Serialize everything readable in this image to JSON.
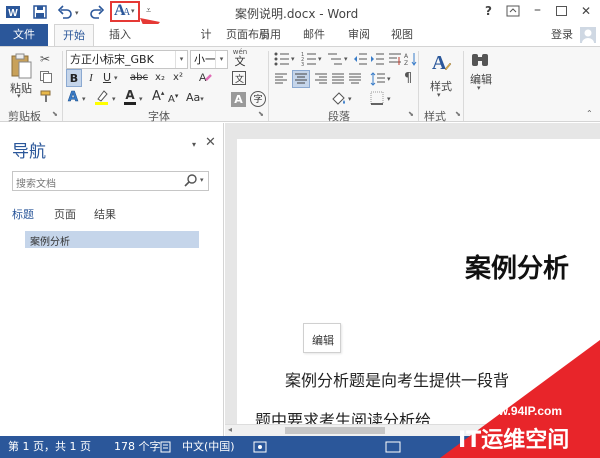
{
  "title_bar": {
    "window_title": "案例说明.docx - Word",
    "help": "?",
    "minimize": "–",
    "close": "✕"
  },
  "tabs": {
    "file": "文件",
    "home": "开始",
    "insert": "插入",
    "design_partial": "计",
    "layout": "页面布局",
    "references": "引用",
    "mailings": "邮件",
    "review": "审阅",
    "view": "视图",
    "signin": "登录"
  },
  "ribbon": {
    "paste": "粘贴",
    "clipboard_group": "剪贴板",
    "font_name": "方正小标宋_GBK",
    "font_size": "小一",
    "font_group": "字体",
    "paragraph_group": "段落",
    "styles_button": "样式",
    "styles_group": "样式",
    "editing_button": "编辑",
    "wen": "wén",
    "wen_char": "文",
    "shade_char": "A",
    "enclose_char": "字",
    "grow": "A",
    "shrink": "A",
    "aa": "Aa",
    "bold": "B",
    "italic": "I",
    "underline": "U",
    "strike": "abc",
    "sub": "x₂",
    "sup": "x²",
    "font_color_a": "A",
    "char_a": "A"
  },
  "nav": {
    "title": "导航",
    "search_placeholder": "搜索文档",
    "tab_headings": "标题",
    "tab_pages": "页面",
    "tab_results": "结果",
    "heading_item": "案例分析"
  },
  "doc": {
    "heading": "案例分析",
    "edit_label": "编辑",
    "line1": "案例分析题是向考生提供一段背",
    "line2": "题中要求考生阅读分析给"
  },
  "status": {
    "page": "第 1 页，共 1 页",
    "words": "178 个字",
    "lang": "中文(中国)"
  },
  "watermark": {
    "url": "www.94IP.com",
    "text": "IT运维空间"
  },
  "colors": {
    "accent": "#2b579a",
    "highlight_arrow": "#e53935",
    "watermark_red": "#e8252a"
  }
}
